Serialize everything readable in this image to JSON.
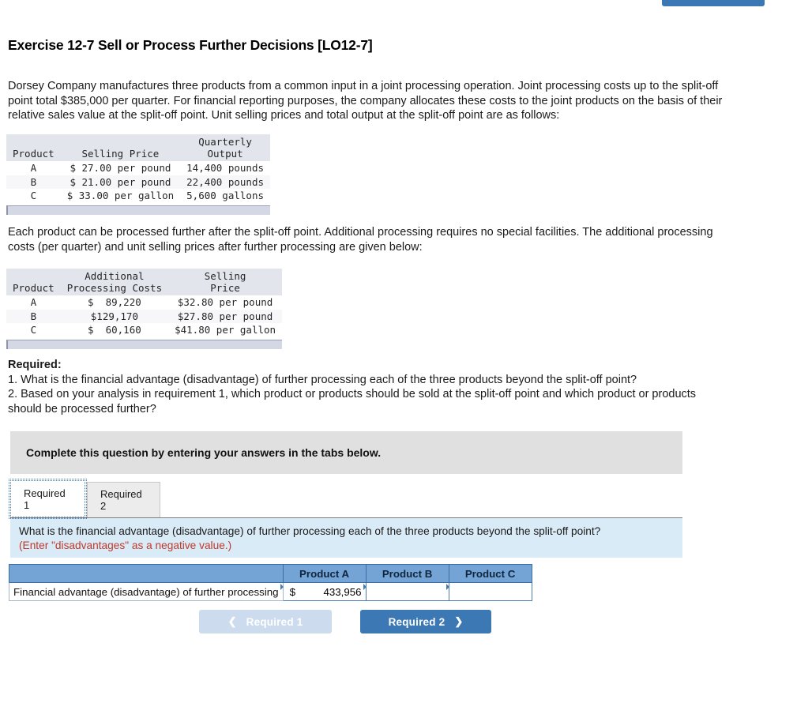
{
  "topbar": {
    "cut_button_label": "",
    "accent_color": "#3c78b4"
  },
  "title": "Exercise 12-7 Sell or Process Further Decisions [LO12-7]",
  "paragraphs": {
    "intro": "Dorsey Company manufactures three products from a common input in a joint processing operation. Joint processing costs up to the split-off point total $385,000 per quarter. For financial reporting purposes, the company allocates these costs to the joint products on the basis of their relative sales value at the split-off point. Unit selling prices and total output at the split-off point are as follows:",
    "further": "Each product can be processed further after the split-off point. Additional processing requires no special facilities. The additional processing costs (per quarter) and unit selling prices after further processing are given below:"
  },
  "table_splitoff": {
    "headers": {
      "product": "Product",
      "selling_price": "Selling Price",
      "output_line1": "Quarterly",
      "output_line2": "Output"
    },
    "rows": [
      {
        "product": "A",
        "selling_price": "$ 27.00 per pound",
        "output": "14,400 pounds"
      },
      {
        "product": "B",
        "selling_price": "$ 21.00 per pound",
        "output": "22,400 pounds"
      },
      {
        "product": "C",
        "selling_price": "$ 33.00 per gallon",
        "output": "5,600 gallons"
      }
    ]
  },
  "table_further": {
    "headers": {
      "product": "Product",
      "cost_line1": "Additional",
      "cost_line2": "Processing Costs",
      "price_line1": "Selling",
      "price_line2": "Price"
    },
    "rows": [
      {
        "product": "A",
        "cost": "$  89,220",
        "price": "$32.80 per pound"
      },
      {
        "product": "B",
        "cost": "$129,170",
        "price": "$27.80 per pound"
      },
      {
        "product": "C",
        "cost": "$  60,160",
        "price": "$41.80 per gallon"
      }
    ]
  },
  "required": {
    "heading": "Required:",
    "item1": "1. What is the financial advantage (disadvantage) of further processing each of the three products beyond the split-off point?",
    "item2": "2. Based on your analysis in requirement 1, which product or products should be sold at the split-off point and which product or products should be processed further?"
  },
  "instruction_bar": {
    "text": "Complete this question by entering your answers in the tabs below."
  },
  "tabs": [
    {
      "label": "Required 1",
      "active": true
    },
    {
      "label": "Required 2",
      "active": false
    }
  ],
  "question_panel": {
    "question": "What is the financial advantage (disadvantage) of further processing each of the three products beyond the split-off point?",
    "hint": "(Enter \"disadvantages\" as a negative value.)",
    "hint_color": "#c0392b",
    "background": "#d9ebf7"
  },
  "answer_table": {
    "header_color": "#74a3d6",
    "columns": [
      "",
      "Product A",
      "Product B",
      "Product C"
    ],
    "row_label": "Financial advantage (disadvantage) of further processing",
    "cells": [
      {
        "currency": "$",
        "value": "433,956"
      },
      {
        "currency": "",
        "value": ""
      },
      {
        "currency": "",
        "value": ""
      }
    ]
  },
  "nav": {
    "prev_label": "Required 1",
    "prev_icon": "chevron-left-icon",
    "prev_chevron": "❮",
    "next_label": "Required 2",
    "next_icon": "chevron-right-icon",
    "next_chevron": "❯",
    "next_color": "#3c78b4",
    "prev_color": "#ccdcee"
  }
}
